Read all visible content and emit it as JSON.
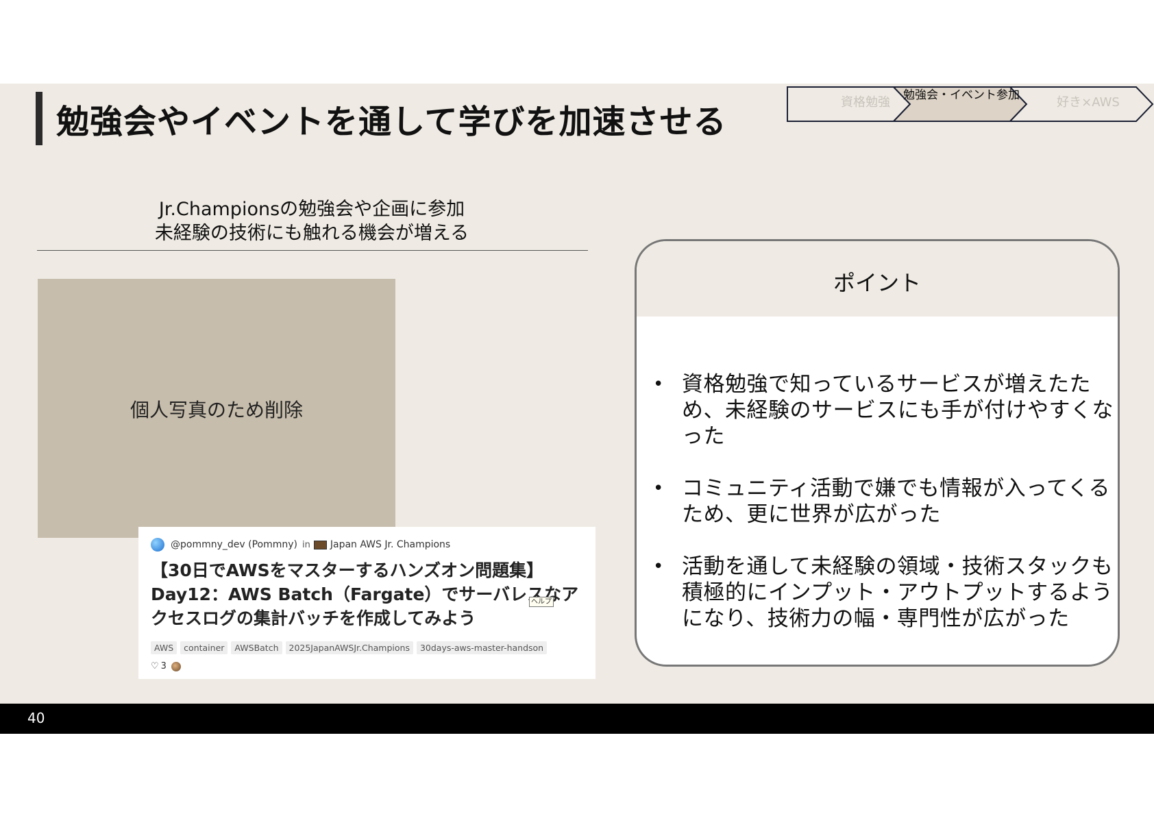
{
  "slide": {
    "title": "勉強会やイベントを通して学びを加速させる",
    "nav": [
      {
        "label": "資格勉強",
        "active": false
      },
      {
        "label": "勉強会・イベント参加",
        "active": true
      },
      {
        "label": "好き×AWS",
        "active": false
      }
    ],
    "subtitle_line1": "Jr.Championsの勉強会や企画に参加",
    "subtitle_line2": "未経験の技術にも触れる機会が増える",
    "photo_placeholder": "個人写真のため削除",
    "article": {
      "author": "@pommny_dev (Pommny)",
      "in_label": "in",
      "publication": "Japan AWS Jr. Champions",
      "title": "【30日でAWSをマスターするハンズオン問題集】Day12：AWS Batch（Fargate）でサーバレスなアクセスログの集計バッチを作成してみよう",
      "help_tag": "ヘルプ",
      "tags": [
        "AWS",
        "container",
        "AWSBatch",
        "2025JapanAWSJr.Champions",
        "30days-aws-master-handson"
      ],
      "likes": "3"
    },
    "point": {
      "title": "ポイント",
      "bullets": [
        "資格勉強で知っているサービスが増えたため、未経験のサービスにも手が付けやすくなった",
        "コミュニティ活動で嫌でも情報が入ってくるため、更に世界が広がった",
        "活動を通して未経験の領域・技術スタックも積極的にインプット・アウトプットするようになり、技術力の幅・専門性が広がった"
      ]
    },
    "page_number": "40"
  },
  "colors": {
    "background": "#efebe4",
    "photo_placeholder": "#c7bdac",
    "nav_active": "#ddd3c6",
    "nav_border": "#1a1f33",
    "footer": "#000000"
  }
}
